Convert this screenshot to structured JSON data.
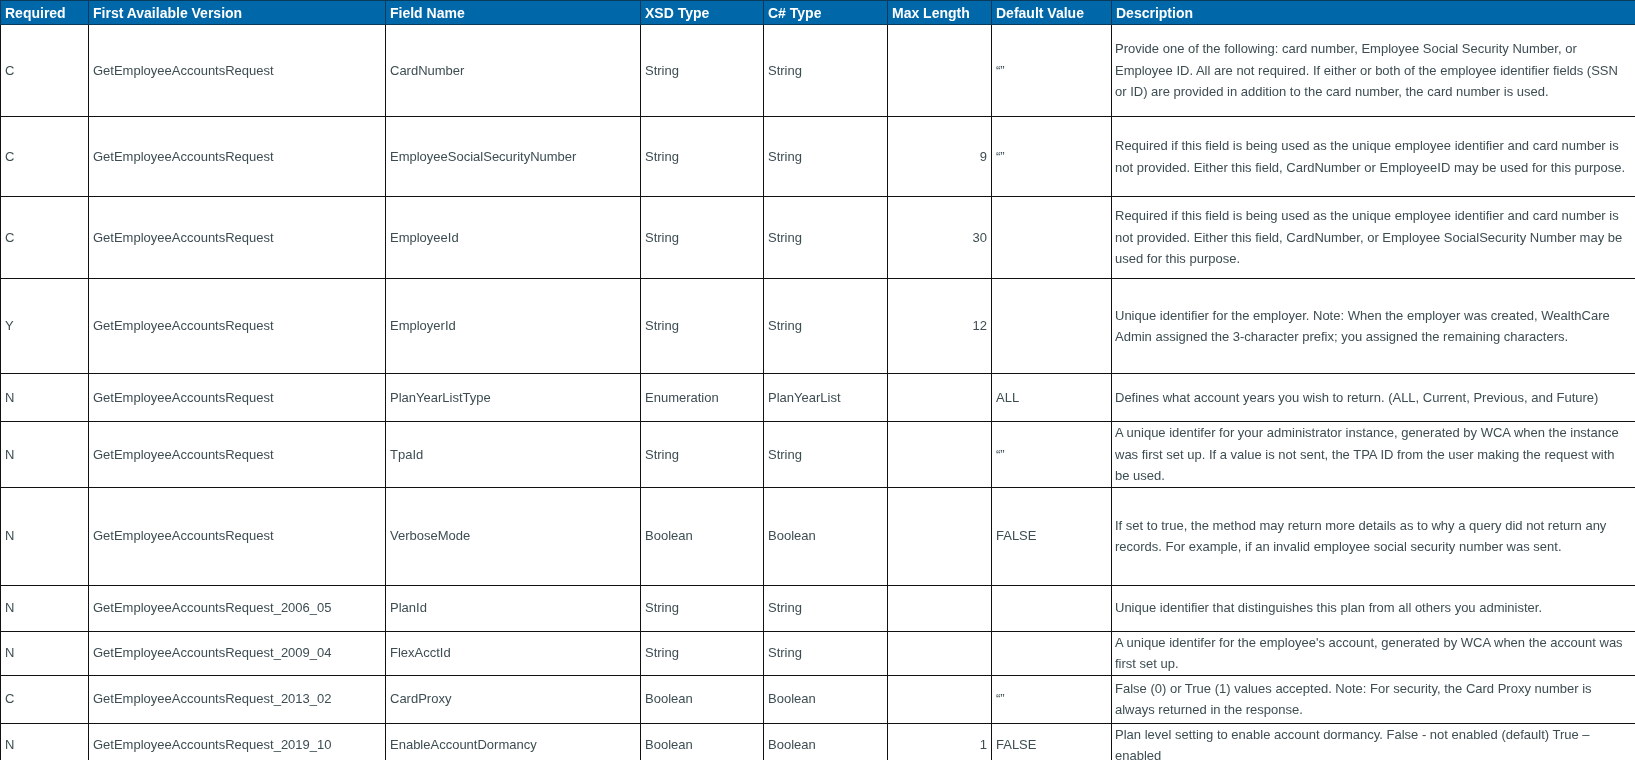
{
  "table": {
    "columns": [
      "Required",
      "First Available Version",
      "Field Name",
      "XSD Type",
      "C# Type",
      "Max Length",
      "Default Value",
      "Description"
    ],
    "rows": [
      {
        "required": "C",
        "version": "GetEmployeeAccountsRequest",
        "field_name": "CardNumber",
        "xsd_type": "String",
        "csharp_type": "String",
        "max_length": "",
        "default_value": "“”",
        "description": "Provide one of the following: card number, Employee Social Security Number, or Employee ID. All are not required. If either or both of the employee identifier fields (SSN or ID) are provided in addition to the card number, the card number is used."
      },
      {
        "required": "C",
        "version": "GetEmployeeAccountsRequest",
        "field_name": "EmployeeSocialSecurityNumber",
        "xsd_type": "String",
        "csharp_type": "String",
        "max_length": "9",
        "default_value": "“”",
        "description": "Required if this field is being used as the unique employee identifier and card number is not provided. Either this field, CardNumber or EmployeeID may be used for this purpose."
      },
      {
        "required": "C",
        "version": "GetEmployeeAccountsRequest",
        "field_name": "EmployeeId",
        "xsd_type": "String",
        "csharp_type": "String",
        "max_length": "30",
        "default_value": "",
        "description": "Required if this field is being used as the unique employee identifier and card number is not provided. Either this field, CardNumber, or Employee SocialSecurity Number may be used for this purpose."
      },
      {
        "required": "Y",
        "version": "GetEmployeeAccountsRequest",
        "field_name": "EmployerId",
        "xsd_type": "String",
        "csharp_type": "String",
        "max_length": "12",
        "default_value": "",
        "description": "Unique identifier for the employer. Note: When the employer was created, WealthCare Admin assigned the 3-character prefix; you assigned the remaining characters."
      },
      {
        "required": "N",
        "version": "GetEmployeeAccountsRequest",
        "field_name": "PlanYearListType",
        "xsd_type": "Enumeration",
        "csharp_type": "PlanYearList",
        "max_length": "",
        "default_value": "ALL",
        "description": "Defines what account years you wish to return. (ALL, Current, Previous, and Future)"
      },
      {
        "required": "N",
        "version": "GetEmployeeAccountsRequest",
        "field_name": "TpaId",
        "xsd_type": "String",
        "csharp_type": "String",
        "max_length": "",
        "default_value": "“”",
        "description": "A unique identifer for your administrator instance, generated by WCA when the instance was first set up. If a value is not sent, the TPA ID from the user making the request with be used."
      },
      {
        "required": "N",
        "version": "GetEmployeeAccountsRequest",
        "field_name": "VerboseMode",
        "xsd_type": "Boolean",
        "csharp_type": "Boolean",
        "max_length": "",
        "default_value": "FALSE",
        "description": "If set to true, the method may return more details as to why a query did not return any records. For example, if an invalid employee social security number was sent."
      },
      {
        "required": "N",
        "version": "GetEmployeeAccountsRequest_2006_05",
        "field_name": "PlanId",
        "xsd_type": "String",
        "csharp_type": "String",
        "max_length": "",
        "default_value": "",
        "description": "Unique identifier that distinguishes this plan from all others you administer."
      },
      {
        "required": "N",
        "version": "GetEmployeeAccountsRequest_2009_04",
        "field_name": "FlexAcctId",
        "xsd_type": "String",
        "csharp_type": "String",
        "max_length": "",
        "default_value": "",
        "description": "A unique identifer for the employee's account, generated by WCA when the account was first set up."
      },
      {
        "required": "C",
        "version": "GetEmployeeAccountsRequest_2013_02",
        "field_name": "CardProxy",
        "xsd_type": "Boolean",
        "csharp_type": "Boolean",
        "max_length": "",
        "default_value": "“”",
        "description": "False (0) or True (1) values accepted. Note: For security, the Card Proxy number is always returned in the response."
      },
      {
        "required": "N",
        "version": "GetEmployeeAccountsRequest_2019_10",
        "field_name": "EnableAccountDormancy",
        "xsd_type": "Boolean",
        "csharp_type": "Boolean",
        "max_length": "1",
        "default_value": "FALSE",
        "description": "Plan level setting to enable account dormancy.  False - not enabled (default) True – enabled"
      }
    ]
  }
}
